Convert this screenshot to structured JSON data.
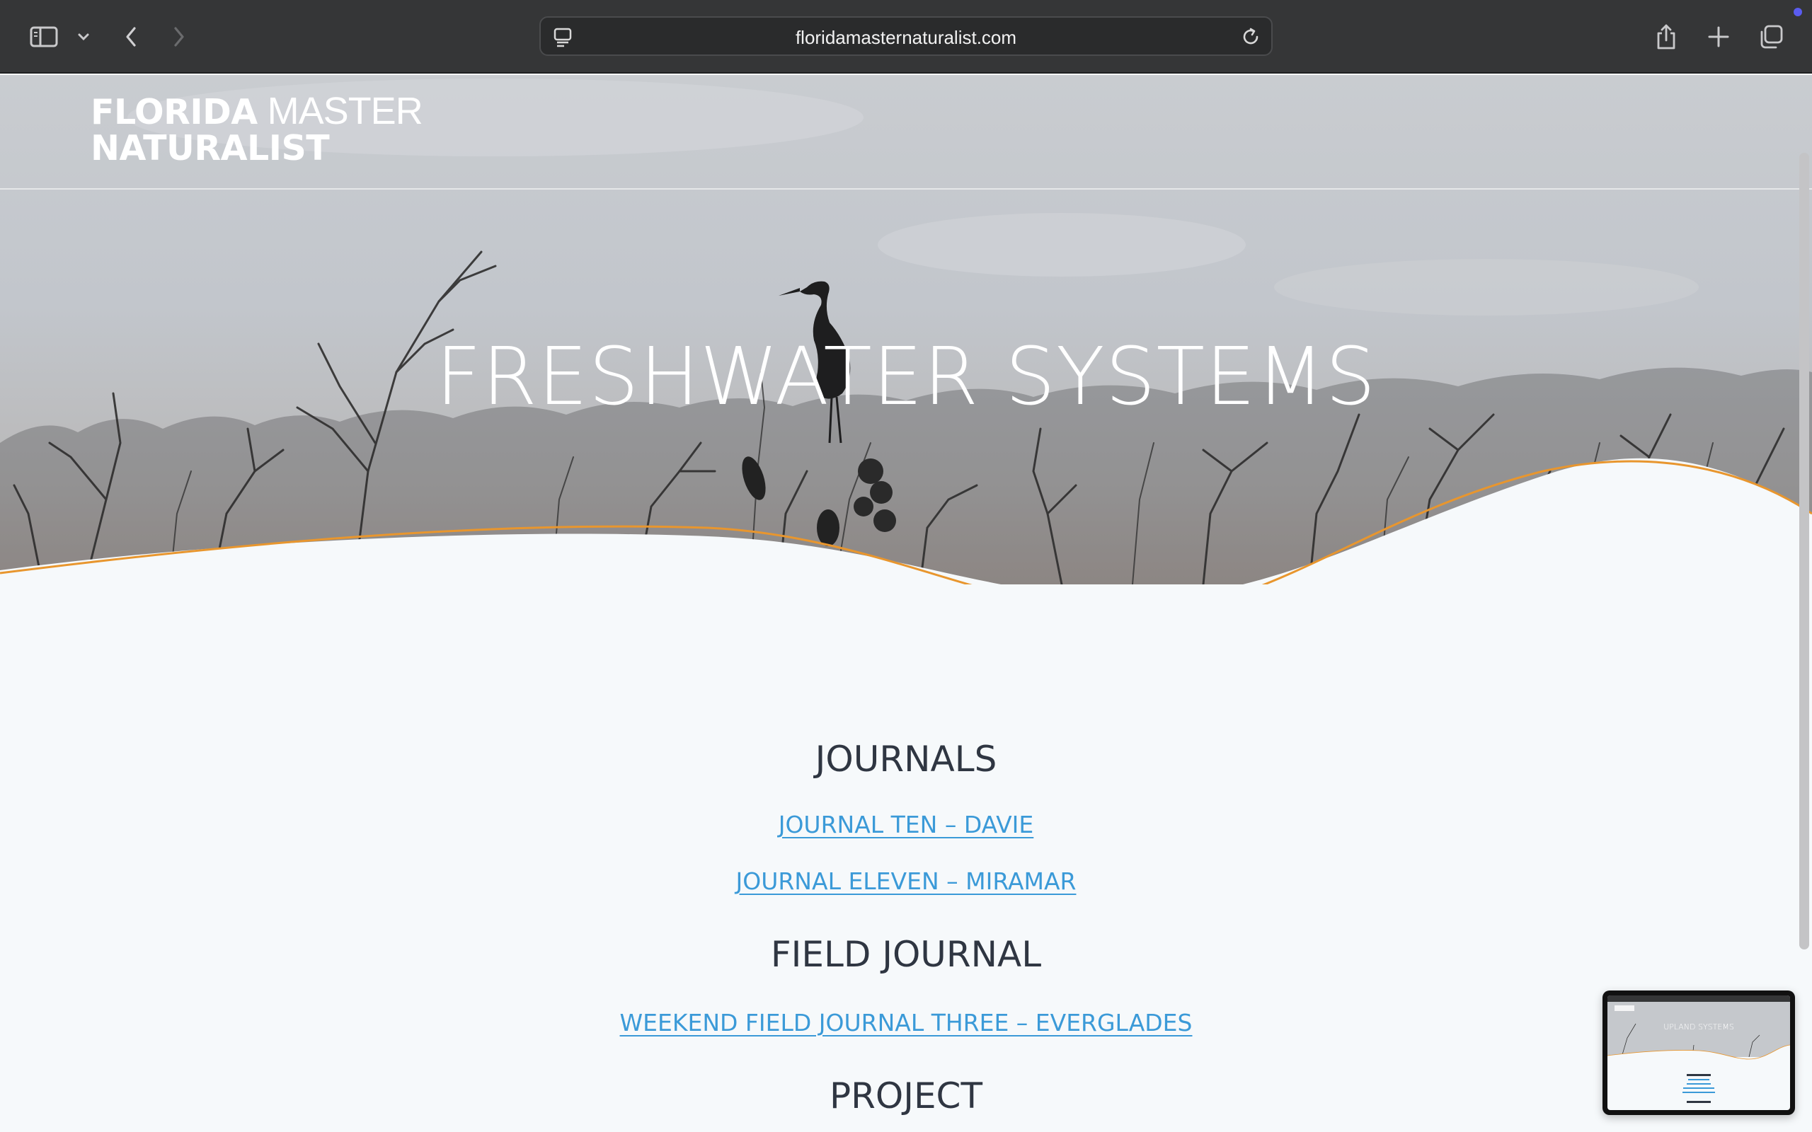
{
  "browser": {
    "url": "floridamasternaturalist.com",
    "icons": {
      "sidebar": "sidebar-icon",
      "tab_overview_menu": "chevron-down-icon",
      "back": "chevron-left-icon",
      "forward": "chevron-right-icon",
      "site": "page-icon",
      "reload": "reload-icon",
      "share": "share-icon",
      "new_tab": "plus-icon",
      "tabs": "tabs-icon"
    },
    "colors": {
      "chrome": "#353637",
      "notification": "#5a5cf0"
    }
  },
  "site": {
    "logo_line1_bold": "FLORIDA",
    "logo_line1_light": " MASTER",
    "logo_line2_bold": "NATURALIST"
  },
  "hero": {
    "title": "FRESHWATER SYSTEMS",
    "accent_color": "#e8962e"
  },
  "sections": [
    {
      "heading": "JOURNALS",
      "links": [
        "JOURNAL TEN – DAVIE",
        "JOURNAL ELEVEN – MIRAMAR"
      ]
    },
    {
      "heading": "FIELD JOURNAL",
      "links": [
        "WEEKEND FIELD JOURNAL THREE – EVERGLADES"
      ]
    },
    {
      "heading": "PROJECT",
      "links": []
    }
  ],
  "thumbnail": {
    "title": "UPLAND SYSTEMS",
    "heading1": "JOURNALS",
    "heading2": "FIELD JOURNAL"
  },
  "colors": {
    "link": "#3b9ad8",
    "heading": "#2f3642",
    "page_bg": "#f6f9fb"
  }
}
